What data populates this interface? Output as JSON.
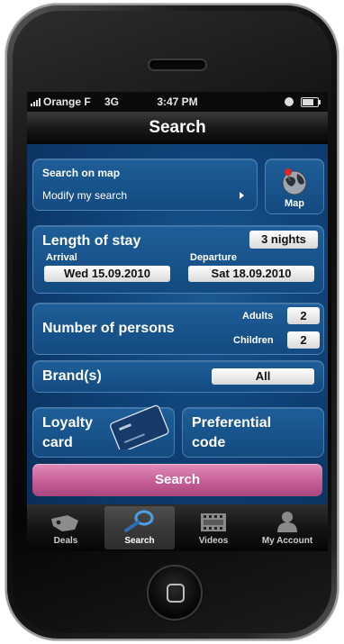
{
  "status_bar": {
    "carrier": "Orange F",
    "network": "3G",
    "time": "3:47 PM"
  },
  "nav": {
    "title": "Search"
  },
  "map_panel": {
    "title": "Search on map",
    "subtitle": "Modify my search",
    "map_label": "Map"
  },
  "stay": {
    "label": "Length of stay",
    "nights": "3 nights",
    "arrival_label": "Arrival",
    "arrival_value": "Wed 15.09.2010",
    "departure_label": "Departure",
    "departure_value": "Sat 18.09.2010"
  },
  "persons": {
    "label": "Number of persons",
    "adults_label": "Adults",
    "adults_value": "2",
    "children_label": "Children",
    "children_value": "2"
  },
  "brands": {
    "label": "Brand(s)",
    "value": "All"
  },
  "loyalty": {
    "label_line1": "Loyalty",
    "label_line2": "card"
  },
  "preferential": {
    "label_line1": "Preferential",
    "label_line2": "code"
  },
  "search_button": {
    "label": "Search"
  },
  "tabs": [
    {
      "label": "Deals",
      "icon": "tag-icon"
    },
    {
      "label": "Search",
      "icon": "magnifier-icon"
    },
    {
      "label": "Videos",
      "icon": "film-icon"
    },
    {
      "label": "My Account",
      "icon": "person-icon"
    }
  ],
  "colors": {
    "screen_bg": "#0f4279",
    "panel": "#1e5e98",
    "search_button": "#c65e96",
    "pill": "#ffffff"
  }
}
